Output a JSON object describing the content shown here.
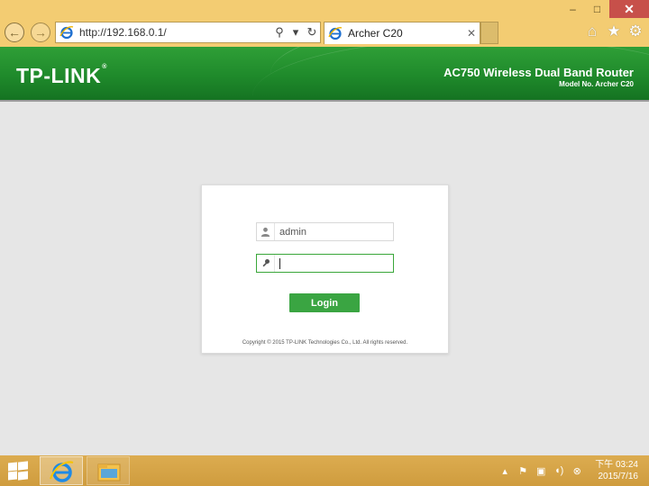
{
  "browser": {
    "url": "http://192.168.0.1/",
    "tab_title": "Archer C20",
    "window_controls": {
      "minimize": "–",
      "maximize": "□",
      "close": "✕"
    }
  },
  "header": {
    "logo": "TP-LINK",
    "product_name": "AC750 Wireless Dual Band Router",
    "model": "Model No. Archer C20"
  },
  "login": {
    "username_value": "admin",
    "password_value": "",
    "login_label": "Login",
    "copyright": "Copyright © 2015 TP-LINK Technologies Co., Ltd. All rights reserved."
  },
  "taskbar": {
    "apps": [
      "internet-explorer",
      "file-explorer"
    ],
    "clock_time": "下午 03:24",
    "clock_date": "2015/7/16"
  },
  "colors": {
    "chrome": "#f3cc72",
    "header_green": "#1f8a2b",
    "login_button": "#3aa542",
    "taskbar": "#d9a84a"
  }
}
